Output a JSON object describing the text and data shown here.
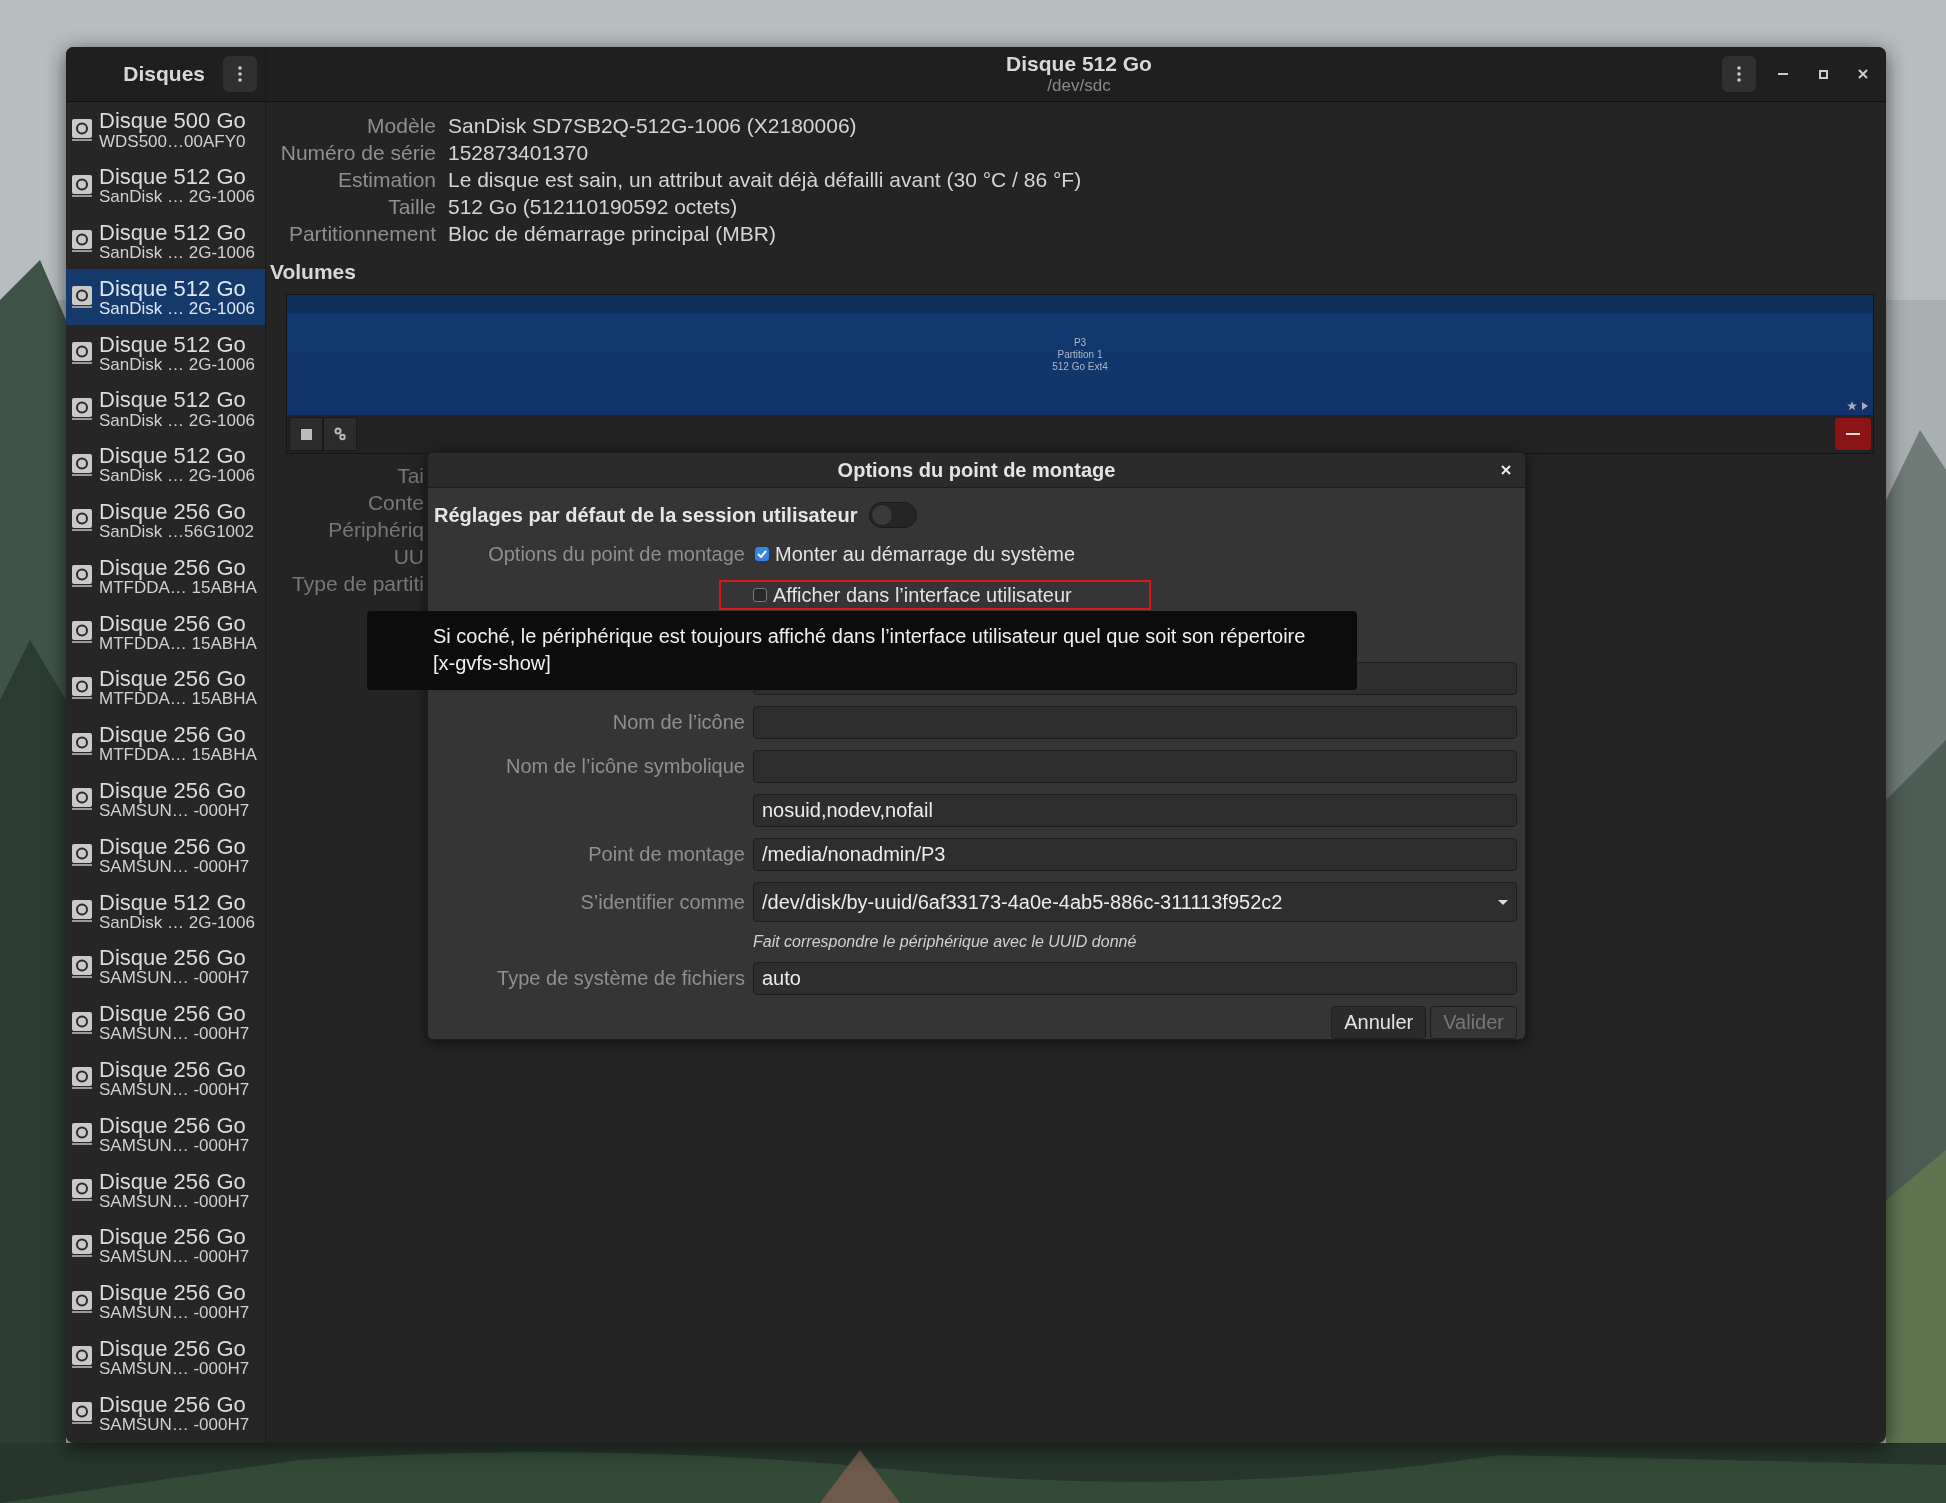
{
  "window": {
    "title": "Disque 512 Go",
    "subtitle": "/dev/sdc"
  },
  "sidebar": {
    "title": "Disques",
    "items": [
      {
        "name": "Disque 500 Go",
        "model": "WDS500…00AFY0",
        "selected": false
      },
      {
        "name": "Disque 512 Go",
        "model": "SanDisk … 2G-1006",
        "selected": false
      },
      {
        "name": "Disque 512 Go",
        "model": "SanDisk … 2G-1006",
        "selected": false
      },
      {
        "name": "Disque 512 Go",
        "model": "SanDisk … 2G-1006",
        "selected": true
      },
      {
        "name": "Disque 512 Go",
        "model": "SanDisk … 2G-1006",
        "selected": false
      },
      {
        "name": "Disque 512 Go",
        "model": "SanDisk … 2G-1006",
        "selected": false
      },
      {
        "name": "Disque 512 Go",
        "model": "SanDisk … 2G-1006",
        "selected": false
      },
      {
        "name": "Disque 256 Go",
        "model": "SanDisk …56G1002",
        "selected": false
      },
      {
        "name": "Disque 256 Go",
        "model": "MTFDDA… 15ABHA",
        "selected": false
      },
      {
        "name": "Disque 256 Go",
        "model": "MTFDDA… 15ABHA",
        "selected": false
      },
      {
        "name": "Disque 256 Go",
        "model": "MTFDDA… 15ABHA",
        "selected": false
      },
      {
        "name": "Disque 256 Go",
        "model": "MTFDDA… 15ABHA",
        "selected": false
      },
      {
        "name": "Disque 256 Go",
        "model": "SAMSUN… -000H7",
        "selected": false
      },
      {
        "name": "Disque 256 Go",
        "model": "SAMSUN… -000H7",
        "selected": false
      },
      {
        "name": "Disque 512 Go",
        "model": "SanDisk … 2G-1006",
        "selected": false
      },
      {
        "name": "Disque 256 Go",
        "model": "SAMSUN… -000H7",
        "selected": false
      },
      {
        "name": "Disque 256 Go",
        "model": "SAMSUN… -000H7",
        "selected": false
      },
      {
        "name": "Disque 256 Go",
        "model": "SAMSUN… -000H7",
        "selected": false
      },
      {
        "name": "Disque 256 Go",
        "model": "SAMSUN… -000H7",
        "selected": false
      },
      {
        "name": "Disque 256 Go",
        "model": "SAMSUN… -000H7",
        "selected": false
      },
      {
        "name": "Disque 256 Go",
        "model": "SAMSUN… -000H7",
        "selected": false
      },
      {
        "name": "Disque 256 Go",
        "model": "SAMSUN… -000H7",
        "selected": false
      },
      {
        "name": "Disque 256 Go",
        "model": "SAMSUN… -000H7",
        "selected": false
      },
      {
        "name": "Disque 256 Go",
        "model": "SAMSUN… -000H7",
        "selected": false
      }
    ]
  },
  "drive_info": [
    {
      "label": "Modèle",
      "value": "SanDisk SD7SB2Q-512G-1006 (X2180006)"
    },
    {
      "label": "Numéro de série",
      "value": "152873401370"
    },
    {
      "label": "Estimation",
      "value": "Le disque est sain, un attribut avait déjà défailli avant (30 °C / 86 °F)"
    },
    {
      "label": "Taille",
      "value": "512 Go (512110190592 octets)"
    },
    {
      "label": "Partitionnement",
      "value": "Bloc de démarrage principal (MBR)"
    }
  ],
  "volumes": {
    "heading": "Volumes",
    "partition_lines": [
      "P3",
      "Partition 1",
      "512 Go Ext4"
    ]
  },
  "volume_detail_labels": [
    "Tai",
    "Conte",
    "Périphériq",
    "UU",
    "Type de partiti"
  ],
  "dialog": {
    "title": "Options du point de montage",
    "session_defaults": {
      "label": "Réglages par défaut de la session utilisateur",
      "on": false
    },
    "options_label": "Options du point de montage",
    "checkboxes": [
      {
        "label": "Monter au démarrage du système",
        "checked": true,
        "highlighted": false
      },
      {
        "label": "Afficher dans l’interface utilisateur",
        "checked": false,
        "highlighted": true
      }
    ],
    "fields": [
      {
        "kind": "entry"
      },
      {
        "kind": "entry",
        "label": "Nom de l’icône"
      },
      {
        "kind": "entry",
        "label": "Nom de l’icône symbolique"
      },
      {
        "kind": "entry",
        "value": "nosuid,nodev,nofail"
      },
      {
        "kind": "entry",
        "label": "Point de montage",
        "value": "/media/nonadmin/P3"
      },
      {
        "kind": "combo",
        "label": "S’identifier comme",
        "value": "/dev/disk/by-uuid/6af33173-4a0e-4ab5-886c-311113f952c2",
        "hint": "Fait correspondre le périphérique avec le UUID donné"
      },
      {
        "kind": "entry",
        "label": "Type de système de fichiers",
        "value": "auto"
      }
    ],
    "buttons": [
      {
        "label": "Annuler",
        "disabled": false
      },
      {
        "label": "Valider",
        "disabled": true
      }
    ]
  },
  "tooltip": {
    "text": "Si coché, le périphérique est toujours affiché dans l’interface utilisateur quel que soit son répertoire [x-gvfs-show]"
  }
}
